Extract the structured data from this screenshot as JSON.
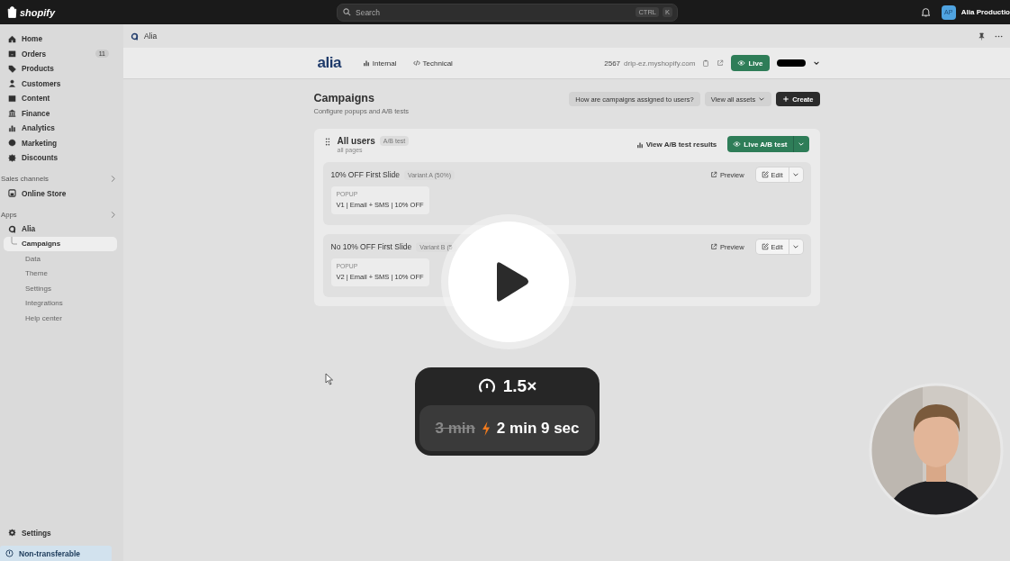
{
  "top_bar": {
    "logo": "shopify",
    "search": {
      "placeholder": "Search",
      "keys": [
        "CTRL",
        "K"
      ]
    },
    "store": {
      "initials": "AP",
      "name": "Alia Productio"
    }
  },
  "sidebar": {
    "main": [
      {
        "label": "Home",
        "selected": false
      },
      {
        "label": "Orders",
        "badge": "11",
        "selected": false
      },
      {
        "label": "Products",
        "selected": false
      },
      {
        "label": "Customers",
        "selected": false
      },
      {
        "label": "Content",
        "selected": false
      },
      {
        "label": "Finance",
        "selected": false
      },
      {
        "label": "Analytics",
        "selected": false
      },
      {
        "label": "Marketing",
        "selected": false
      },
      {
        "label": "Discounts",
        "selected": false
      }
    ],
    "sales_channels": {
      "title": "Sales channels",
      "items": [
        {
          "label": "Online Store",
          "selected": false
        }
      ]
    },
    "apps": {
      "title": "Apps",
      "app": {
        "label": "Alia",
        "children": [
          {
            "label": "Campaigns",
            "selected": true
          },
          {
            "label": "Data",
            "selected": false
          },
          {
            "label": "Theme",
            "selected": false
          },
          {
            "label": "Settings",
            "selected": false
          },
          {
            "label": "Integrations",
            "selected": false
          },
          {
            "label": "Help center",
            "selected": false
          }
        ]
      }
    },
    "settings": "Settings",
    "footer": "Non-transferable"
  },
  "app_header": {
    "title": "Alia"
  },
  "app_nav": {
    "logo": "alia",
    "tabs": [
      {
        "label": "Internal"
      },
      {
        "label": "Technical"
      }
    ],
    "store_id": "2567",
    "domain": "drip-ez.myshopify.com",
    "live_button": "Live"
  },
  "page": {
    "title": "Campaigns",
    "subtitle": "Configure popups and A/B tests",
    "actions": [
      {
        "kind": "plain",
        "label": "How are campaigns assigned to users?"
      },
      {
        "kind": "dropdown",
        "label": "View all assets"
      },
      {
        "kind": "primary",
        "label": "Create"
      }
    ]
  },
  "group": {
    "title": "All users",
    "badge": "A/B test",
    "subtitle": "all pages",
    "results_link": "View A/B test results",
    "live_button": "Live A/B test",
    "variants": [
      {
        "name": "10% OFF First Slide",
        "badge": "Variant A (50%)",
        "preview": "Preview",
        "edit": "Edit",
        "type": "POPUP",
        "asset": "V1 | Email + SMS | 10% OFF"
      },
      {
        "name": "No 10% OFF First Slide",
        "badge": "Variant B (5",
        "preview": "Preview",
        "edit": "Edit",
        "type": "POPUP",
        "asset": "V2 | Email + SMS | 10% OFF"
      }
    ]
  },
  "video": {
    "speed": "1.5×",
    "old_time": "3 min",
    "new_time": "2 min 9 sec"
  }
}
